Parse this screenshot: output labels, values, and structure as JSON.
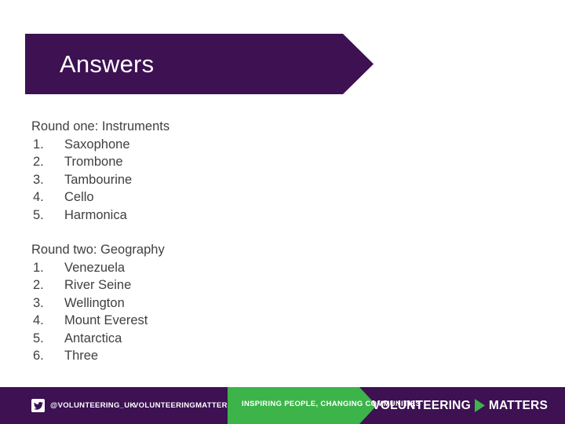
{
  "slide": {
    "title": "Answers",
    "title_banner_color": "#3d1152",
    "background_color": "#ffffff",
    "text_color": "#404040"
  },
  "rounds": [
    {
      "heading": "Round one: Instruments",
      "items": [
        {
          "num": "1.",
          "text": "Saxophone"
        },
        {
          "num": "2.",
          "text": "Trombone"
        },
        {
          "num": "3.",
          "text": "Tambourine"
        },
        {
          "num": "4.",
          "text": "Cello"
        },
        {
          "num": "5.",
          "text": "Harmonica"
        }
      ]
    },
    {
      "heading": "Round two: Geography",
      "items": [
        {
          "num": "1.",
          "text": "Venezuela"
        },
        {
          "num": "2.",
          "text": "River Seine"
        },
        {
          "num": "3.",
          "text": "Wellington"
        },
        {
          "num": "4.",
          "text": "Mount Everest"
        },
        {
          "num": "5.",
          "text": "Antarctica"
        },
        {
          "num": "6.",
          "text": "Three"
        }
      ]
    }
  ],
  "footer": {
    "bar_color": "#3d1152",
    "accent_color": "#3cb44a",
    "twitter_icon": "twitter-bird-icon",
    "twitter_handle": "@VOLUNTEERING_UK",
    "website": "VOLUNTEERINGMATTERS.ORG.UK",
    "tagline": "INSPIRING PEOPLE, CHANGING COMMUNITIES",
    "logo_word_1": "VOLUNTEERING",
    "logo_arrow_icon": "chevron-right-icon",
    "logo_word_2": "MATTERS"
  }
}
